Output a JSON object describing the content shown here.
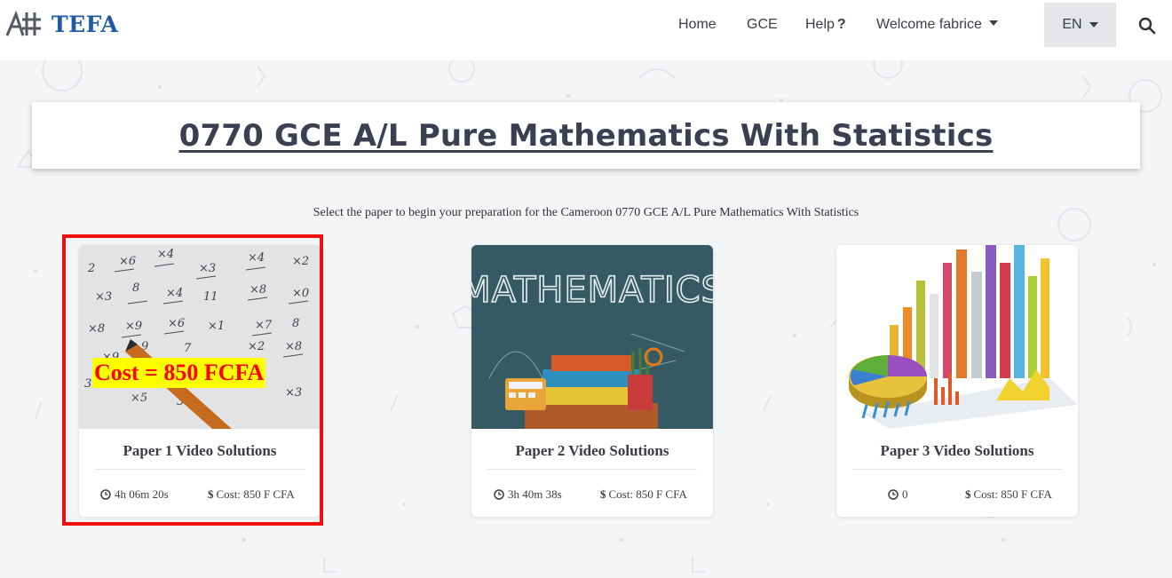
{
  "brand": {
    "name": "TEFA"
  },
  "nav": {
    "home": "Home",
    "gce": "GCE",
    "help": "Help",
    "help_mark": "?",
    "welcome": "Welcome fabrice",
    "language": "EN"
  },
  "page": {
    "title": "0770 GCE A/L Pure Mathematics With Statistics",
    "subtitle": "Select the paper to begin your preparation for the Cameroon 0770 GCE A/L Pure Mathematics With Statistics"
  },
  "annotation": {
    "cost_banner": "Cost = 850 FCFA",
    "highlight_color": "#ef0f0f",
    "banner_bg": "#ffff00"
  },
  "cards": [
    {
      "title": "Paper 1 Video Solutions",
      "duration": "4h 06m 20s",
      "cost": "Cost: 850 F CFA",
      "image": "math-worksheet-image"
    },
    {
      "title": "Paper 2 Video Solutions",
      "duration": "3h 40m 38s",
      "cost": "Cost: 850 F CFA",
      "image": "mathematics-chalkboard-image",
      "image_text": "MATHEMATICS"
    },
    {
      "title": "Paper 3 Video Solutions",
      "duration": "0",
      "cost": "Cost: 850 F CFA",
      "image": "statistics-charts-image"
    }
  ],
  "colors": {
    "brand_blue": "#1f5aa6",
    "title_text": "#3b3f52",
    "background": "#f4f5f7"
  }
}
